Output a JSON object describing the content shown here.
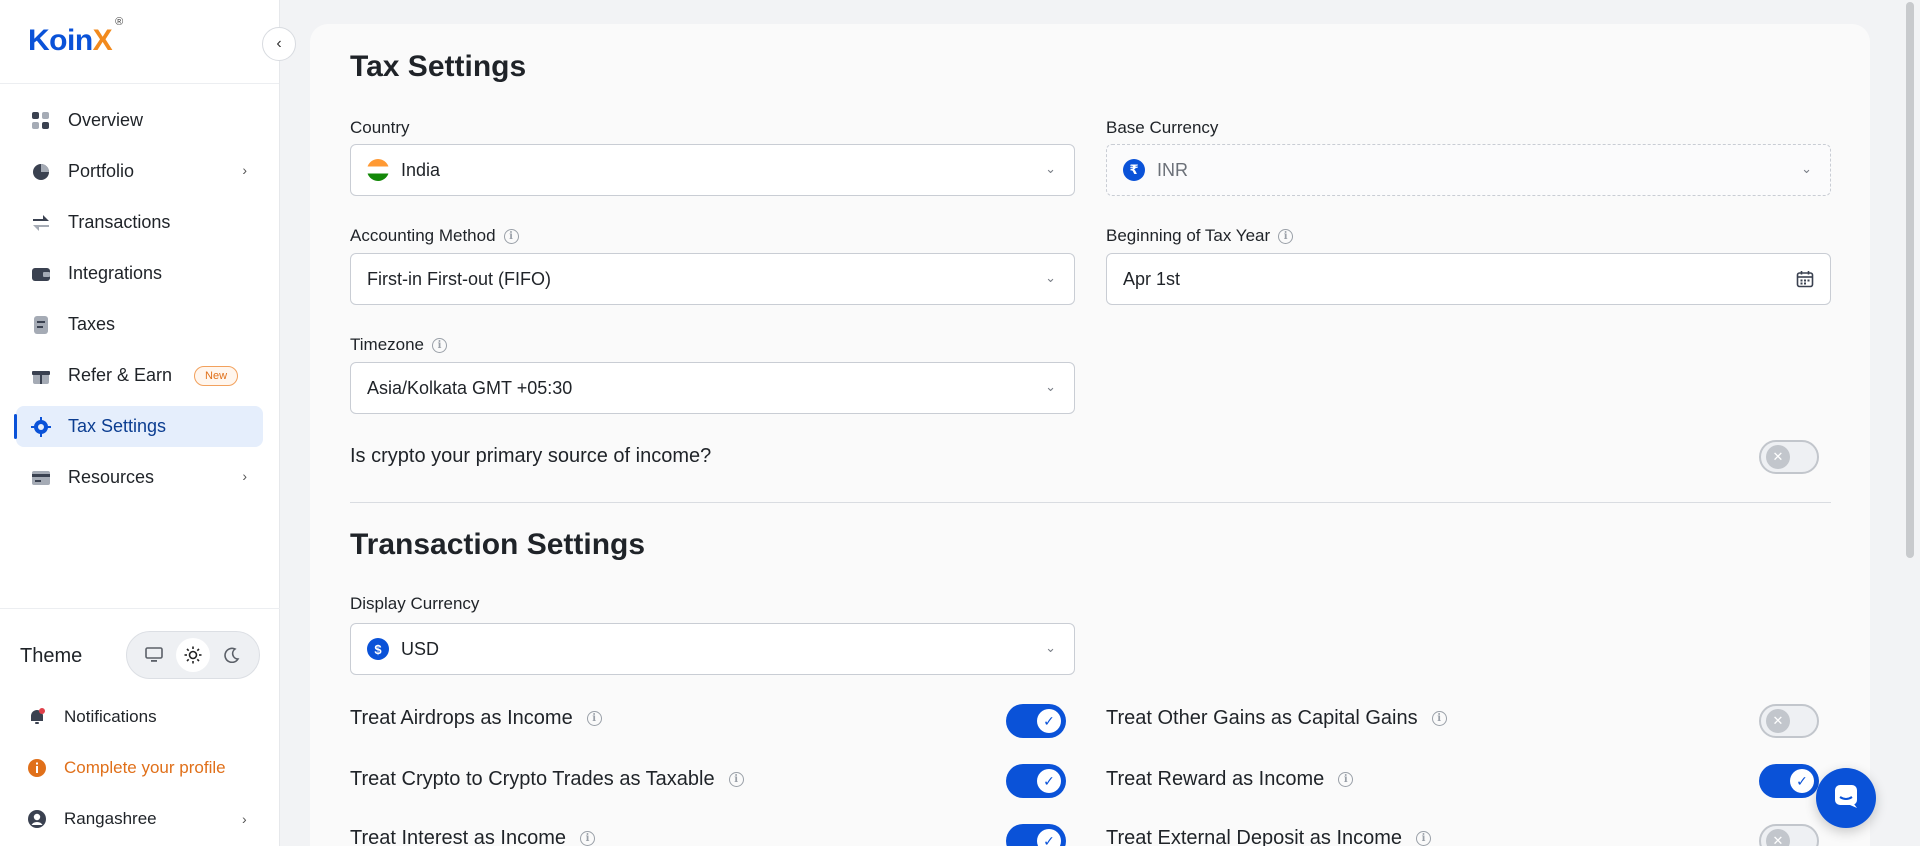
{
  "brand": {
    "name_main": "Koin",
    "name_accent": "X",
    "registered": "®"
  },
  "sidebar": {
    "collapse_icon": "chevron-left-icon",
    "items": [
      {
        "label": "Overview",
        "icon": "grid-icon"
      },
      {
        "label": "Portfolio",
        "icon": "pie-chart-icon",
        "has_chevron": true
      },
      {
        "label": "Transactions",
        "icon": "transfer-icon"
      },
      {
        "label": "Integrations",
        "icon": "wallet-icon"
      },
      {
        "label": "Taxes",
        "icon": "document-icon"
      },
      {
        "label": "Refer & Earn",
        "icon": "gift-icon",
        "badge": "New"
      },
      {
        "label": "Tax Settings",
        "icon": "gear-icon",
        "active": true
      },
      {
        "label": "Resources",
        "icon": "card-icon",
        "has_chevron": true
      }
    ],
    "theme": {
      "label": "Theme",
      "options": [
        "monitor-icon",
        "sun-icon",
        "moon-icon"
      ],
      "selected": "sun-icon"
    },
    "notifications": "Notifications",
    "complete_profile": "Complete your profile",
    "user": "Rangashree"
  },
  "tax_settings": {
    "title": "Tax Settings",
    "country": {
      "label": "Country",
      "value": "India"
    },
    "base_currency": {
      "label": "Base Currency",
      "value": "INR",
      "symbol": "₹"
    },
    "accounting_method": {
      "label": "Accounting Method",
      "value": "First-in First-out (FIFO)"
    },
    "tax_year": {
      "label": "Beginning of Tax Year",
      "value": "Apr 1st"
    },
    "timezone": {
      "label": "Timezone",
      "value": "Asia/Kolkata GMT +05:30"
    },
    "primary_income": {
      "question": "Is crypto your primary source of income?",
      "enabled": false
    }
  },
  "transaction_settings": {
    "title": "Transaction Settings",
    "display_currency": {
      "label": "Display Currency",
      "value": "USD",
      "symbol": "$"
    },
    "options_left": [
      {
        "label": "Treat Airdrops as Income",
        "enabled": true
      },
      {
        "label": "Treat Crypto to Crypto Trades as Taxable",
        "enabled": true
      },
      {
        "label": "Treat Interest as Income",
        "enabled": true
      }
    ],
    "options_right": [
      {
        "label": "Treat Other Gains as Capital Gains",
        "enabled": false
      },
      {
        "label": "Treat Reward as Income",
        "enabled": true
      },
      {
        "label": "Treat External Deposit as Income",
        "enabled": false
      }
    ]
  },
  "colors": {
    "accent": "#0a52d8",
    "orange": "#f28a1d"
  }
}
